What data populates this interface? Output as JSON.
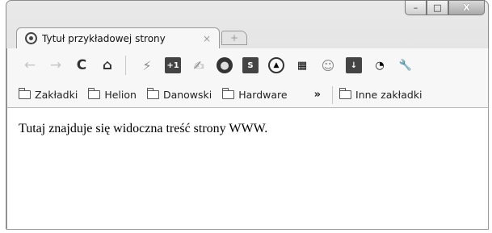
{
  "tab": {
    "title": "Tytuł przykładowej strony",
    "close": "×",
    "new_tab": "+"
  },
  "window_controls": {
    "minimize": "–",
    "maximize": "□",
    "close": "X"
  },
  "toolbar": {
    "buttons": [
      "back-icon",
      "forward-icon",
      "reload-icon",
      "home-icon"
    ],
    "reload_glyph": "C",
    "extensions": [
      "bolt-icon",
      "rss-counter-icon",
      "translate-icon",
      "record-icon",
      "dollar-icon",
      "stop-icon",
      "calendar-icon",
      "smiley-icon",
      "download-icon",
      "signal-icon",
      "wrench-icon"
    ]
  },
  "bookmarks": {
    "items": [
      "Zakładki",
      "Helion",
      "Danowski",
      "Hardware"
    ],
    "overflow": "»",
    "other": "Inne zakładki"
  },
  "page": {
    "text": "Tutaj znajduje się widoczna treść strony WWW."
  }
}
